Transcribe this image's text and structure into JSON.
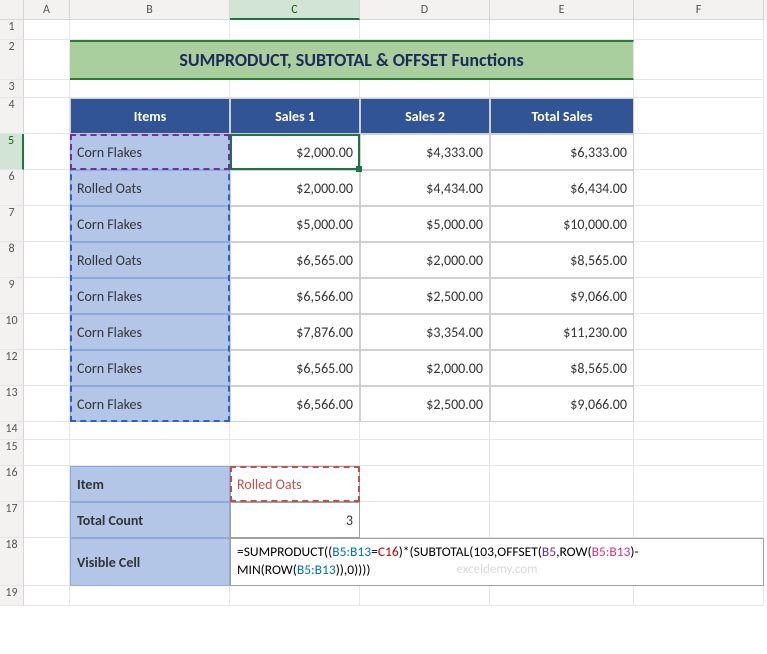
{
  "col_labels": [
    "A",
    "B",
    "C",
    "D",
    "E",
    "F"
  ],
  "row_labels": [
    "1",
    "2",
    "3",
    "4",
    "5",
    "6",
    "7",
    "8",
    "9",
    "10",
    "12",
    "13",
    "14",
    "15",
    "16",
    "17",
    "18",
    "19"
  ],
  "title": "SUMPRODUCT, SUBTOTAL & OFFSET Functions",
  "headers": {
    "items": "Items",
    "s1": "Sales 1",
    "s2": "Sales 2",
    "total": "Total Sales"
  },
  "rows": [
    {
      "item": "Corn Flakes",
      "s1": "$2,000.00",
      "s2": "$4,333.00",
      "total": "$6,333.00"
    },
    {
      "item": "Rolled Oats",
      "s1": "$2,000.00",
      "s2": "$4,434.00",
      "total": "$6,434.00"
    },
    {
      "item": "Corn Flakes",
      "s1": "$5,000.00",
      "s2": "$5,000.00",
      "total": "$10,000.00"
    },
    {
      "item": "Rolled Oats",
      "s1": "$6,565.00",
      "s2": "$2,000.00",
      "total": "$8,565.00"
    },
    {
      "item": "Corn Flakes",
      "s1": "$6,566.00",
      "s2": "$2,500.00",
      "total": "$9,066.00"
    },
    {
      "item": "Corn Flakes",
      "s1": "$7,876.00",
      "s2": "$3,354.00",
      "total": "$11,230.00"
    },
    {
      "item": "Corn Flakes",
      "s1": "$6,565.00",
      "s2": "$2,000.00",
      "total": "$8,565.00"
    },
    {
      "item": "Corn Flakes",
      "s1": "$6,566.00",
      "s2": "$2,500.00",
      "total": "$9,066.00"
    }
  ],
  "summary": {
    "item_label": "Item",
    "item_value": "Rolled Oats",
    "count_label": "Total Count",
    "count_value": "3",
    "visible_label": "Visible Cell"
  },
  "formula_parts": {
    "p1": "=SUMPRODUCT((",
    "r1": "B5:B13",
    "eq": "=",
    "r2": "C16",
    "p2": ")*(SUBTOTAL(103,OFFSET(",
    "r3": "B5",
    "p3": ",ROW(",
    "r4": "B5:B13",
    "p4": ")-MIN(ROW(",
    "r5": "B5:B13",
    "p5": ")),0))))"
  },
  "watermark": "exceldemy.com",
  "chart_data": {
    "type": "table",
    "title": "SUMPRODUCT, SUBTOTAL & OFFSET Functions",
    "columns": [
      "Items",
      "Sales 1",
      "Sales 2",
      "Total Sales"
    ],
    "data": [
      [
        "Corn Flakes",
        2000.0,
        4333.0,
        6333.0
      ],
      [
        "Rolled Oats",
        2000.0,
        4434.0,
        6434.0
      ],
      [
        "Corn Flakes",
        5000.0,
        5000.0,
        10000.0
      ],
      [
        "Rolled Oats",
        6565.0,
        2000.0,
        8565.0
      ],
      [
        "Corn Flakes",
        6566.0,
        2500.0,
        9066.0
      ],
      [
        "Corn Flakes",
        7876.0,
        3354.0,
        11230.0
      ],
      [
        "Corn Flakes",
        6565.0,
        2000.0,
        8565.0
      ],
      [
        "Corn Flakes",
        6566.0,
        2500.0,
        9066.0
      ]
    ],
    "summary": {
      "Item": "Rolled Oats",
      "Total Count": 3
    },
    "formula": "=SUMPRODUCT((B5:B13=C16)*(SUBTOTAL(103,OFFSET(B5,ROW(B5:B13)-MIN(ROW(B5:B13)),0))))"
  }
}
